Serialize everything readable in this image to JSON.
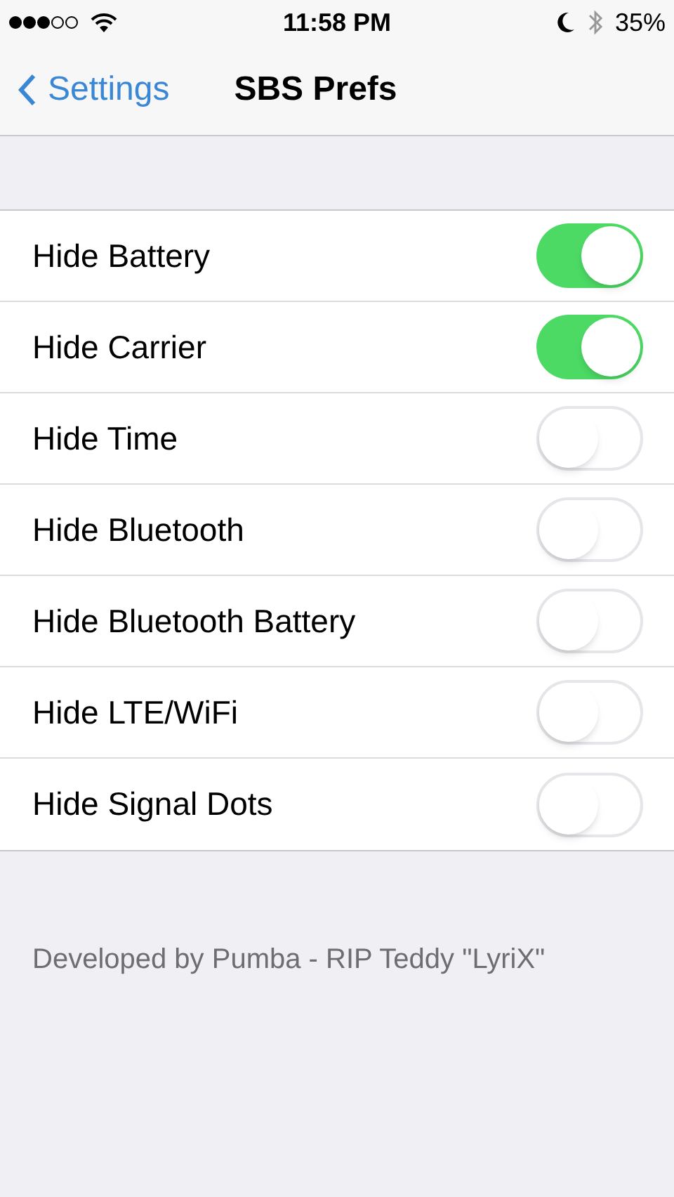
{
  "status_bar": {
    "time": "11:58 PM",
    "battery": "35%"
  },
  "nav": {
    "back": "Settings",
    "title": "SBS Prefs"
  },
  "settings": [
    {
      "label": "Hide Battery",
      "on": true
    },
    {
      "label": "Hide Carrier",
      "on": true
    },
    {
      "label": "Hide Time",
      "on": false
    },
    {
      "label": "Hide Bluetooth",
      "on": false
    },
    {
      "label": "Hide Bluetooth Battery",
      "on": false
    },
    {
      "label": "Hide LTE/WiFi",
      "on": false
    },
    {
      "label": "Hide Signal Dots",
      "on": false
    }
  ],
  "footer": "Developed by Pumba - RIP Teddy \"LyriX\""
}
